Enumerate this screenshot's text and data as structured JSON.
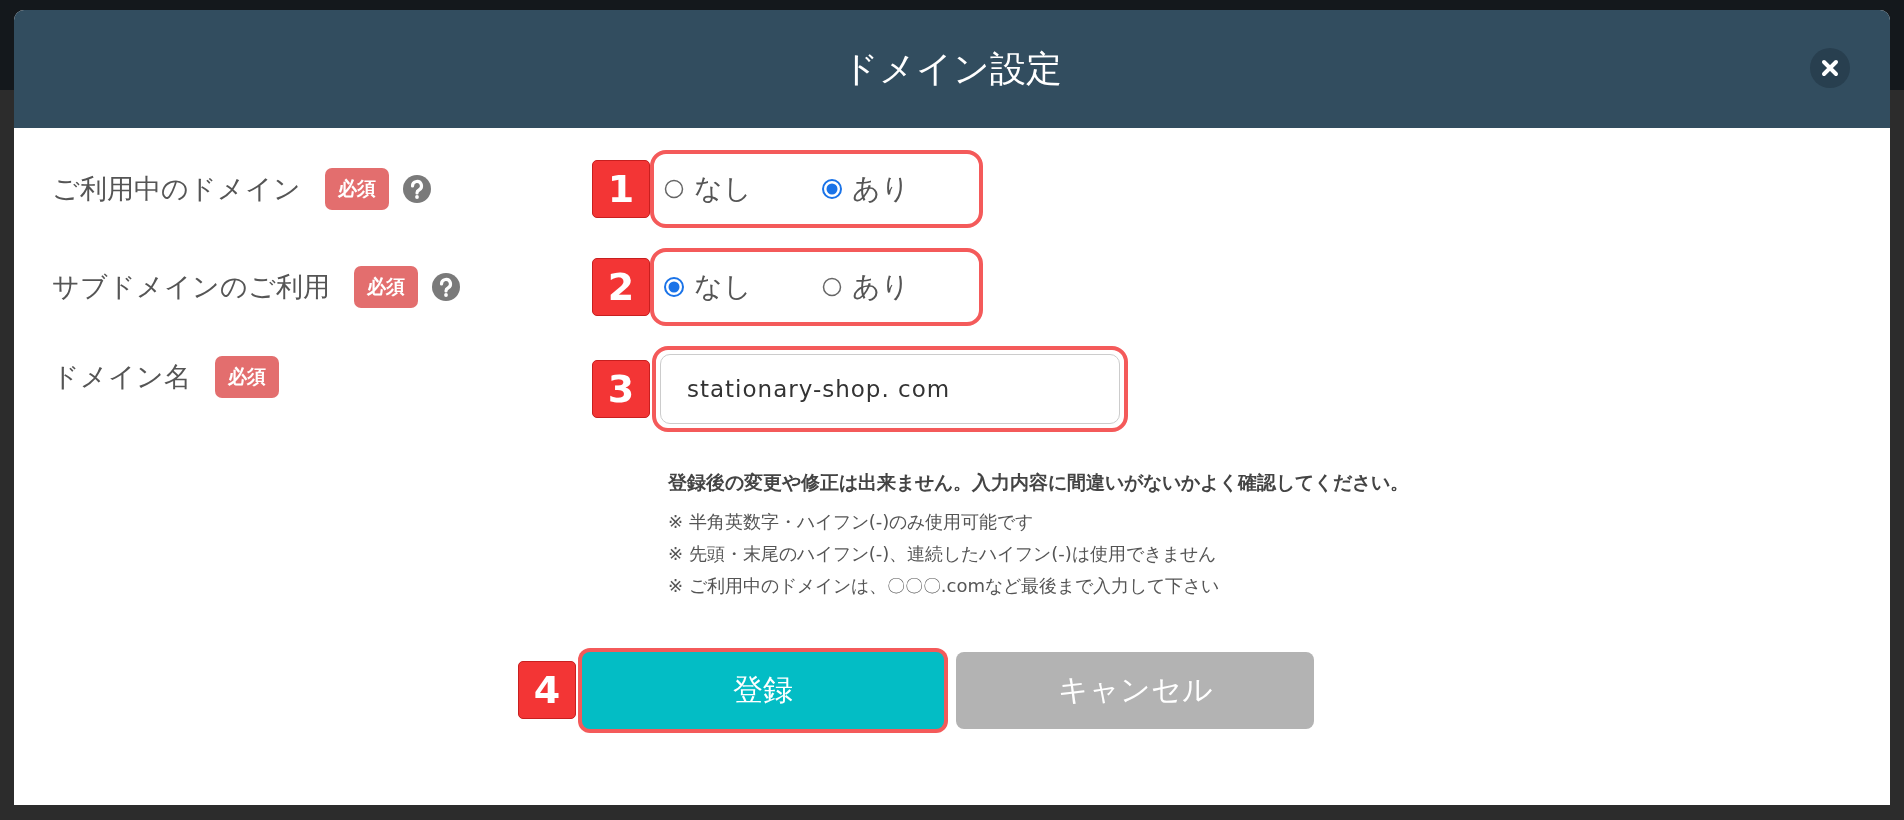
{
  "dialog": {
    "title": "ドメイン設定"
  },
  "fields": [
    {
      "kind": "radio",
      "label": "ご利用中のドメイン",
      "badge": "必須",
      "help": true,
      "annotation": "1",
      "options": [
        {
          "label": "なし",
          "selected": false
        },
        {
          "label": "あり",
          "selected": true
        }
      ]
    },
    {
      "kind": "radio",
      "label": "サブドメインのご利用",
      "badge": "必須",
      "help": true,
      "annotation": "2",
      "options": [
        {
          "label": "なし",
          "selected": true
        },
        {
          "label": "あり",
          "selected": false
        }
      ]
    },
    {
      "kind": "text",
      "label": "ドメイン名",
      "badge": "必須",
      "help": false,
      "annotation": "3",
      "value": "stationary-shop. com"
    }
  ],
  "warning": "登録後の変更や修正は出来ません。入力内容に間違いがないかよく確認してください。",
  "notes": [
    "※ 半角英数字・ハイフン(-)のみ使用可能です",
    "※ 先頭・末尾のハイフン(-)、連続したハイフン(-)は使用できません",
    "※ ご利用中のドメインは、〇〇〇.comなど最後まで入力して下さい"
  ],
  "buttons": [
    {
      "kind": "primary",
      "label": "登録",
      "annotation": "4"
    },
    {
      "kind": "secondary",
      "label": "キャンセル"
    }
  ]
}
